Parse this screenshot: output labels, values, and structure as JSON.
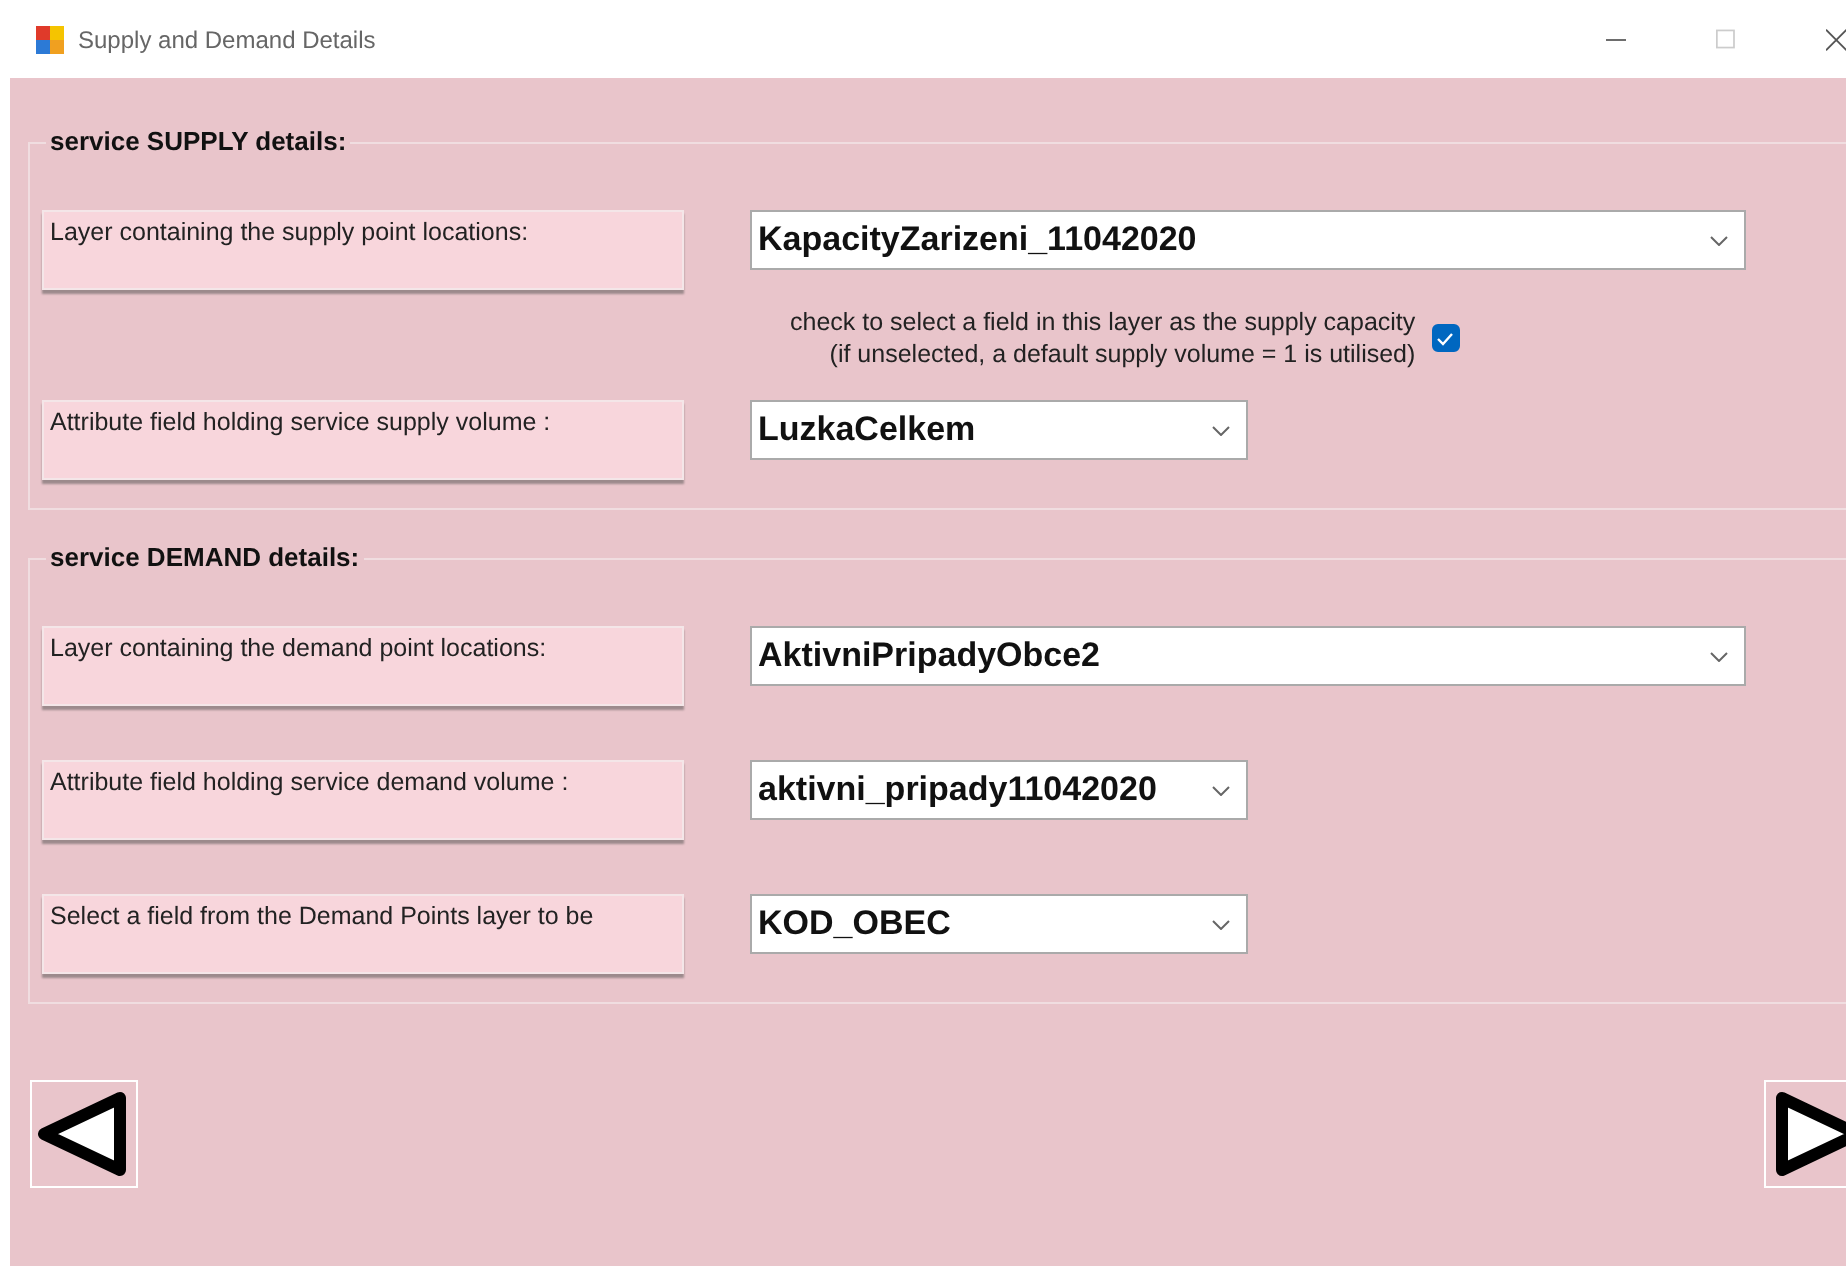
{
  "window": {
    "title": "Supply and Demand Details",
    "controls": [
      {
        "kind": "minimize",
        "disabled": false
      },
      {
        "kind": "maximize",
        "disabled": true
      },
      {
        "kind": "close",
        "disabled": false
      }
    ]
  },
  "sections": [
    {
      "title": "service SUPPLY details:",
      "rows": [
        {
          "kind": "combo",
          "label": "Layer containing the supply point locations:",
          "value": "KapacityZarizeni_11042020",
          "wide": true
        },
        {
          "kind": "checkbox",
          "lines": [
            "check to select a field in this layer as the supply capacity",
            "(if unselected, a default supply volume = 1 is utilised)"
          ],
          "checked": true
        },
        {
          "kind": "combo",
          "label": "Attribute field holding service supply volume :",
          "value": "LuzkaCelkem",
          "wide": false
        }
      ]
    },
    {
      "title": "service DEMAND details:",
      "rows": [
        {
          "kind": "combo",
          "label": "Layer containing the demand point locations:",
          "value": "AktivniPripadyObce2",
          "wide": true
        },
        {
          "kind": "combo",
          "label": "Attribute field holding service demand volume :",
          "value": "aktivni_pripady11042020",
          "wide": false
        },
        {
          "kind": "combo",
          "label": "Select a field from the Demand Points layer to be",
          "value": "KOD_OBEC",
          "wide": false
        }
      ]
    }
  ],
  "nav": [
    {
      "kind": "back"
    },
    {
      "kind": "next"
    }
  ]
}
